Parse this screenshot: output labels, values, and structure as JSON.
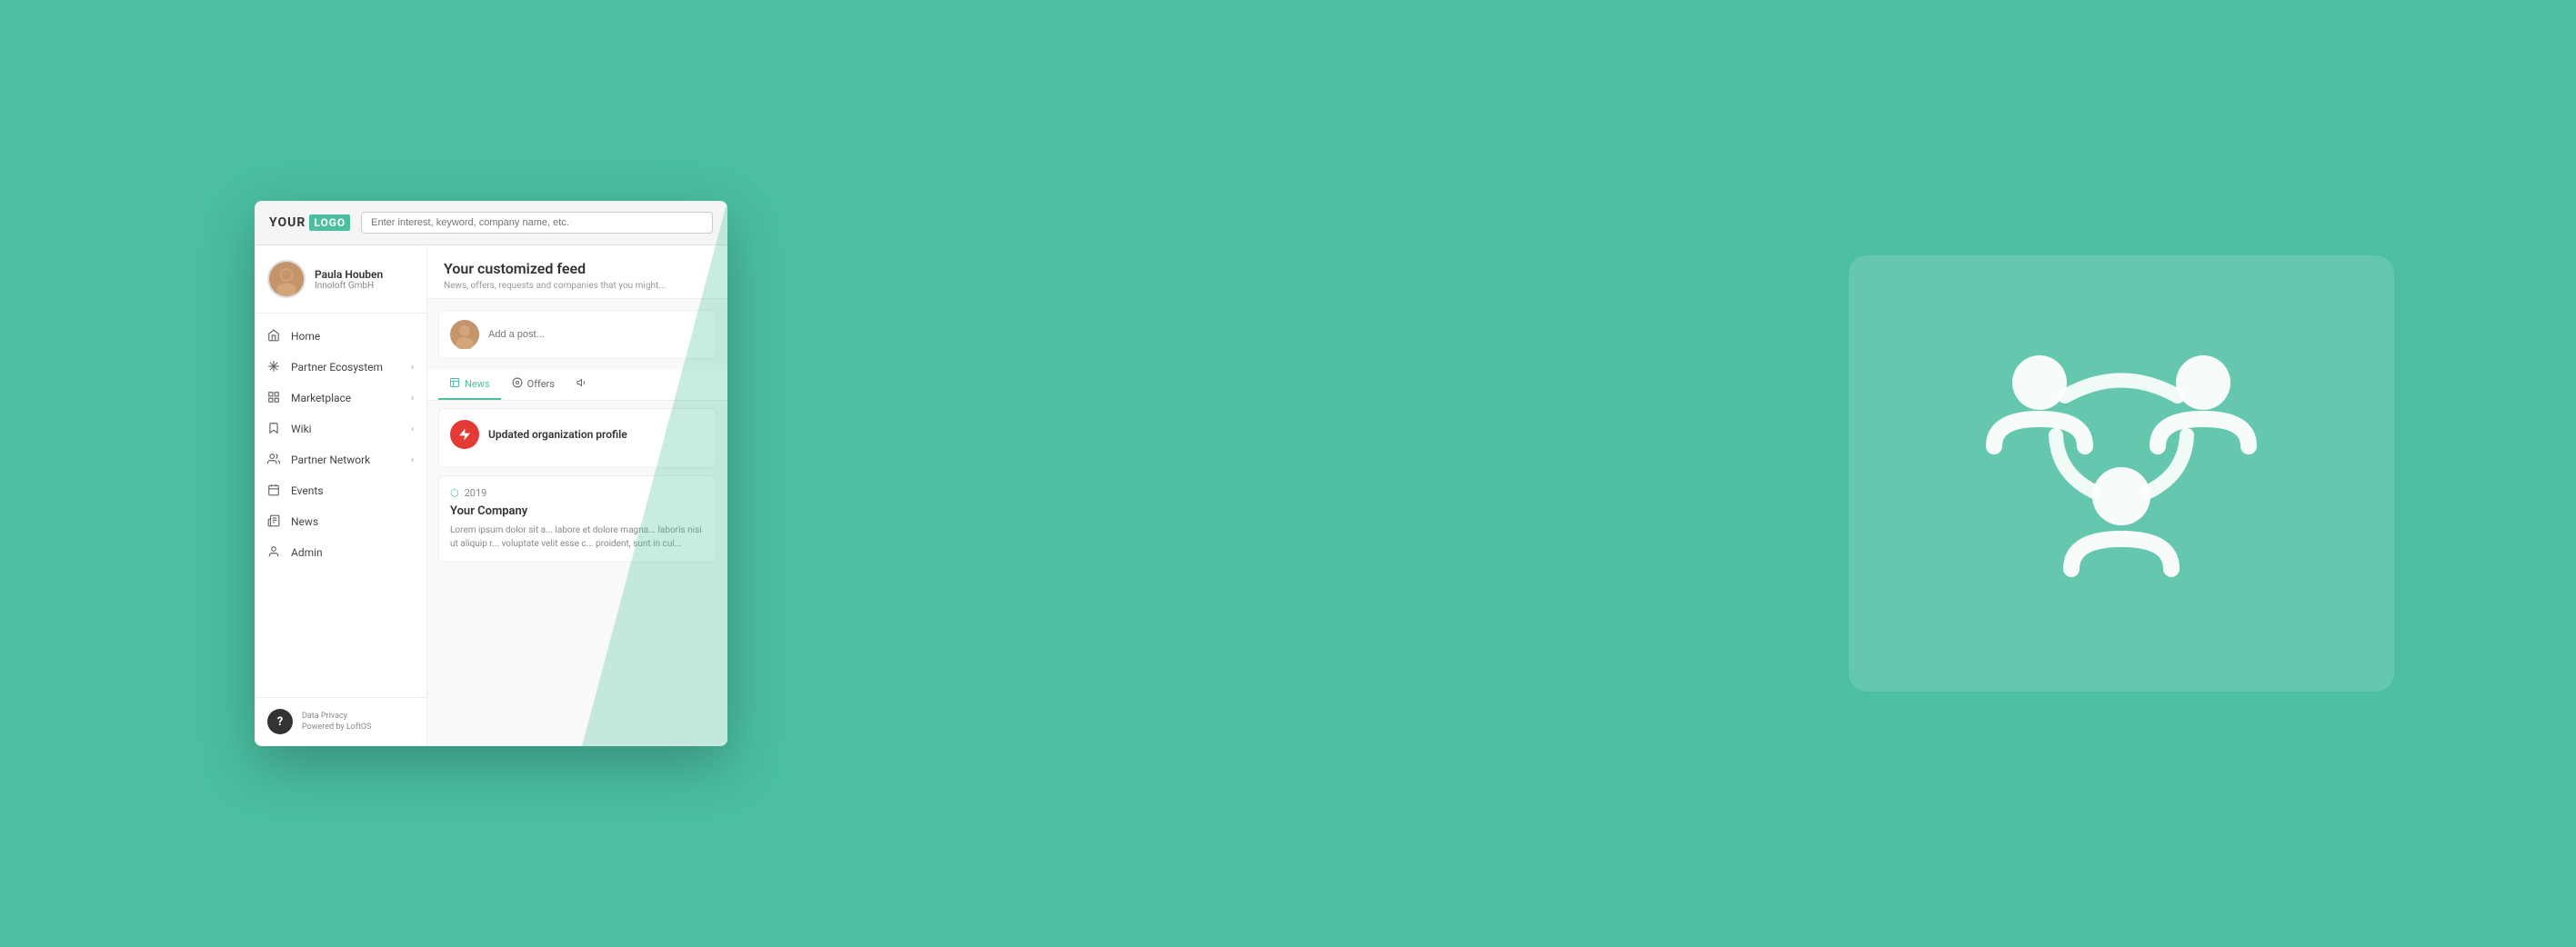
{
  "logo": {
    "your": "YOUR",
    "logo": "LOGO"
  },
  "search": {
    "placeholder": "Enter interest, keyword, company name, etc."
  },
  "user": {
    "name": "Paula Houben",
    "company": "Innoloft GmbH"
  },
  "nav": {
    "items": [
      {
        "id": "home",
        "label": "Home",
        "icon": "home",
        "has_chevron": false
      },
      {
        "id": "partner-ecosystem",
        "label": "Partner Ecosystem",
        "icon": "asterisk",
        "has_chevron": true
      },
      {
        "id": "marketplace",
        "label": "Marketplace",
        "icon": "grid",
        "has_chevron": true
      },
      {
        "id": "wiki",
        "label": "Wiki",
        "icon": "bookmark",
        "has_chevron": true
      },
      {
        "id": "partner-network",
        "label": "Partner Network",
        "icon": "users",
        "has_chevron": true
      },
      {
        "id": "events",
        "label": "Events",
        "icon": "calendar",
        "has_chevron": false
      },
      {
        "id": "news",
        "label": "News",
        "icon": "newspaper",
        "has_chevron": false
      },
      {
        "id": "admin",
        "label": "Admin",
        "icon": "user-shield",
        "has_chevron": false
      }
    ]
  },
  "footer": {
    "data_privacy": "Data Privacy",
    "powered_by": "Powered by LoftOS"
  },
  "feed": {
    "title": "Your customized feed",
    "subtitle": "News, offers, requests and companies that you might...",
    "post_placeholder": "Add a post...",
    "tabs": [
      {
        "id": "news",
        "label": "News",
        "icon": "📰",
        "active": true
      },
      {
        "id": "offers",
        "label": "Offers",
        "icon": "🏷️",
        "active": false
      }
    ],
    "activity_card": {
      "badge": "⚡",
      "title": "Updated organization profile"
    },
    "company_card": {
      "year": "2019",
      "company_name": "Your Company",
      "body": "Lorem ipsum dolor sit a...\nlabore et dolore magna...\nlaboris nisi ut aliquip r...\nvoluptate velit esse c...\nproident, sunt in cul..."
    }
  }
}
